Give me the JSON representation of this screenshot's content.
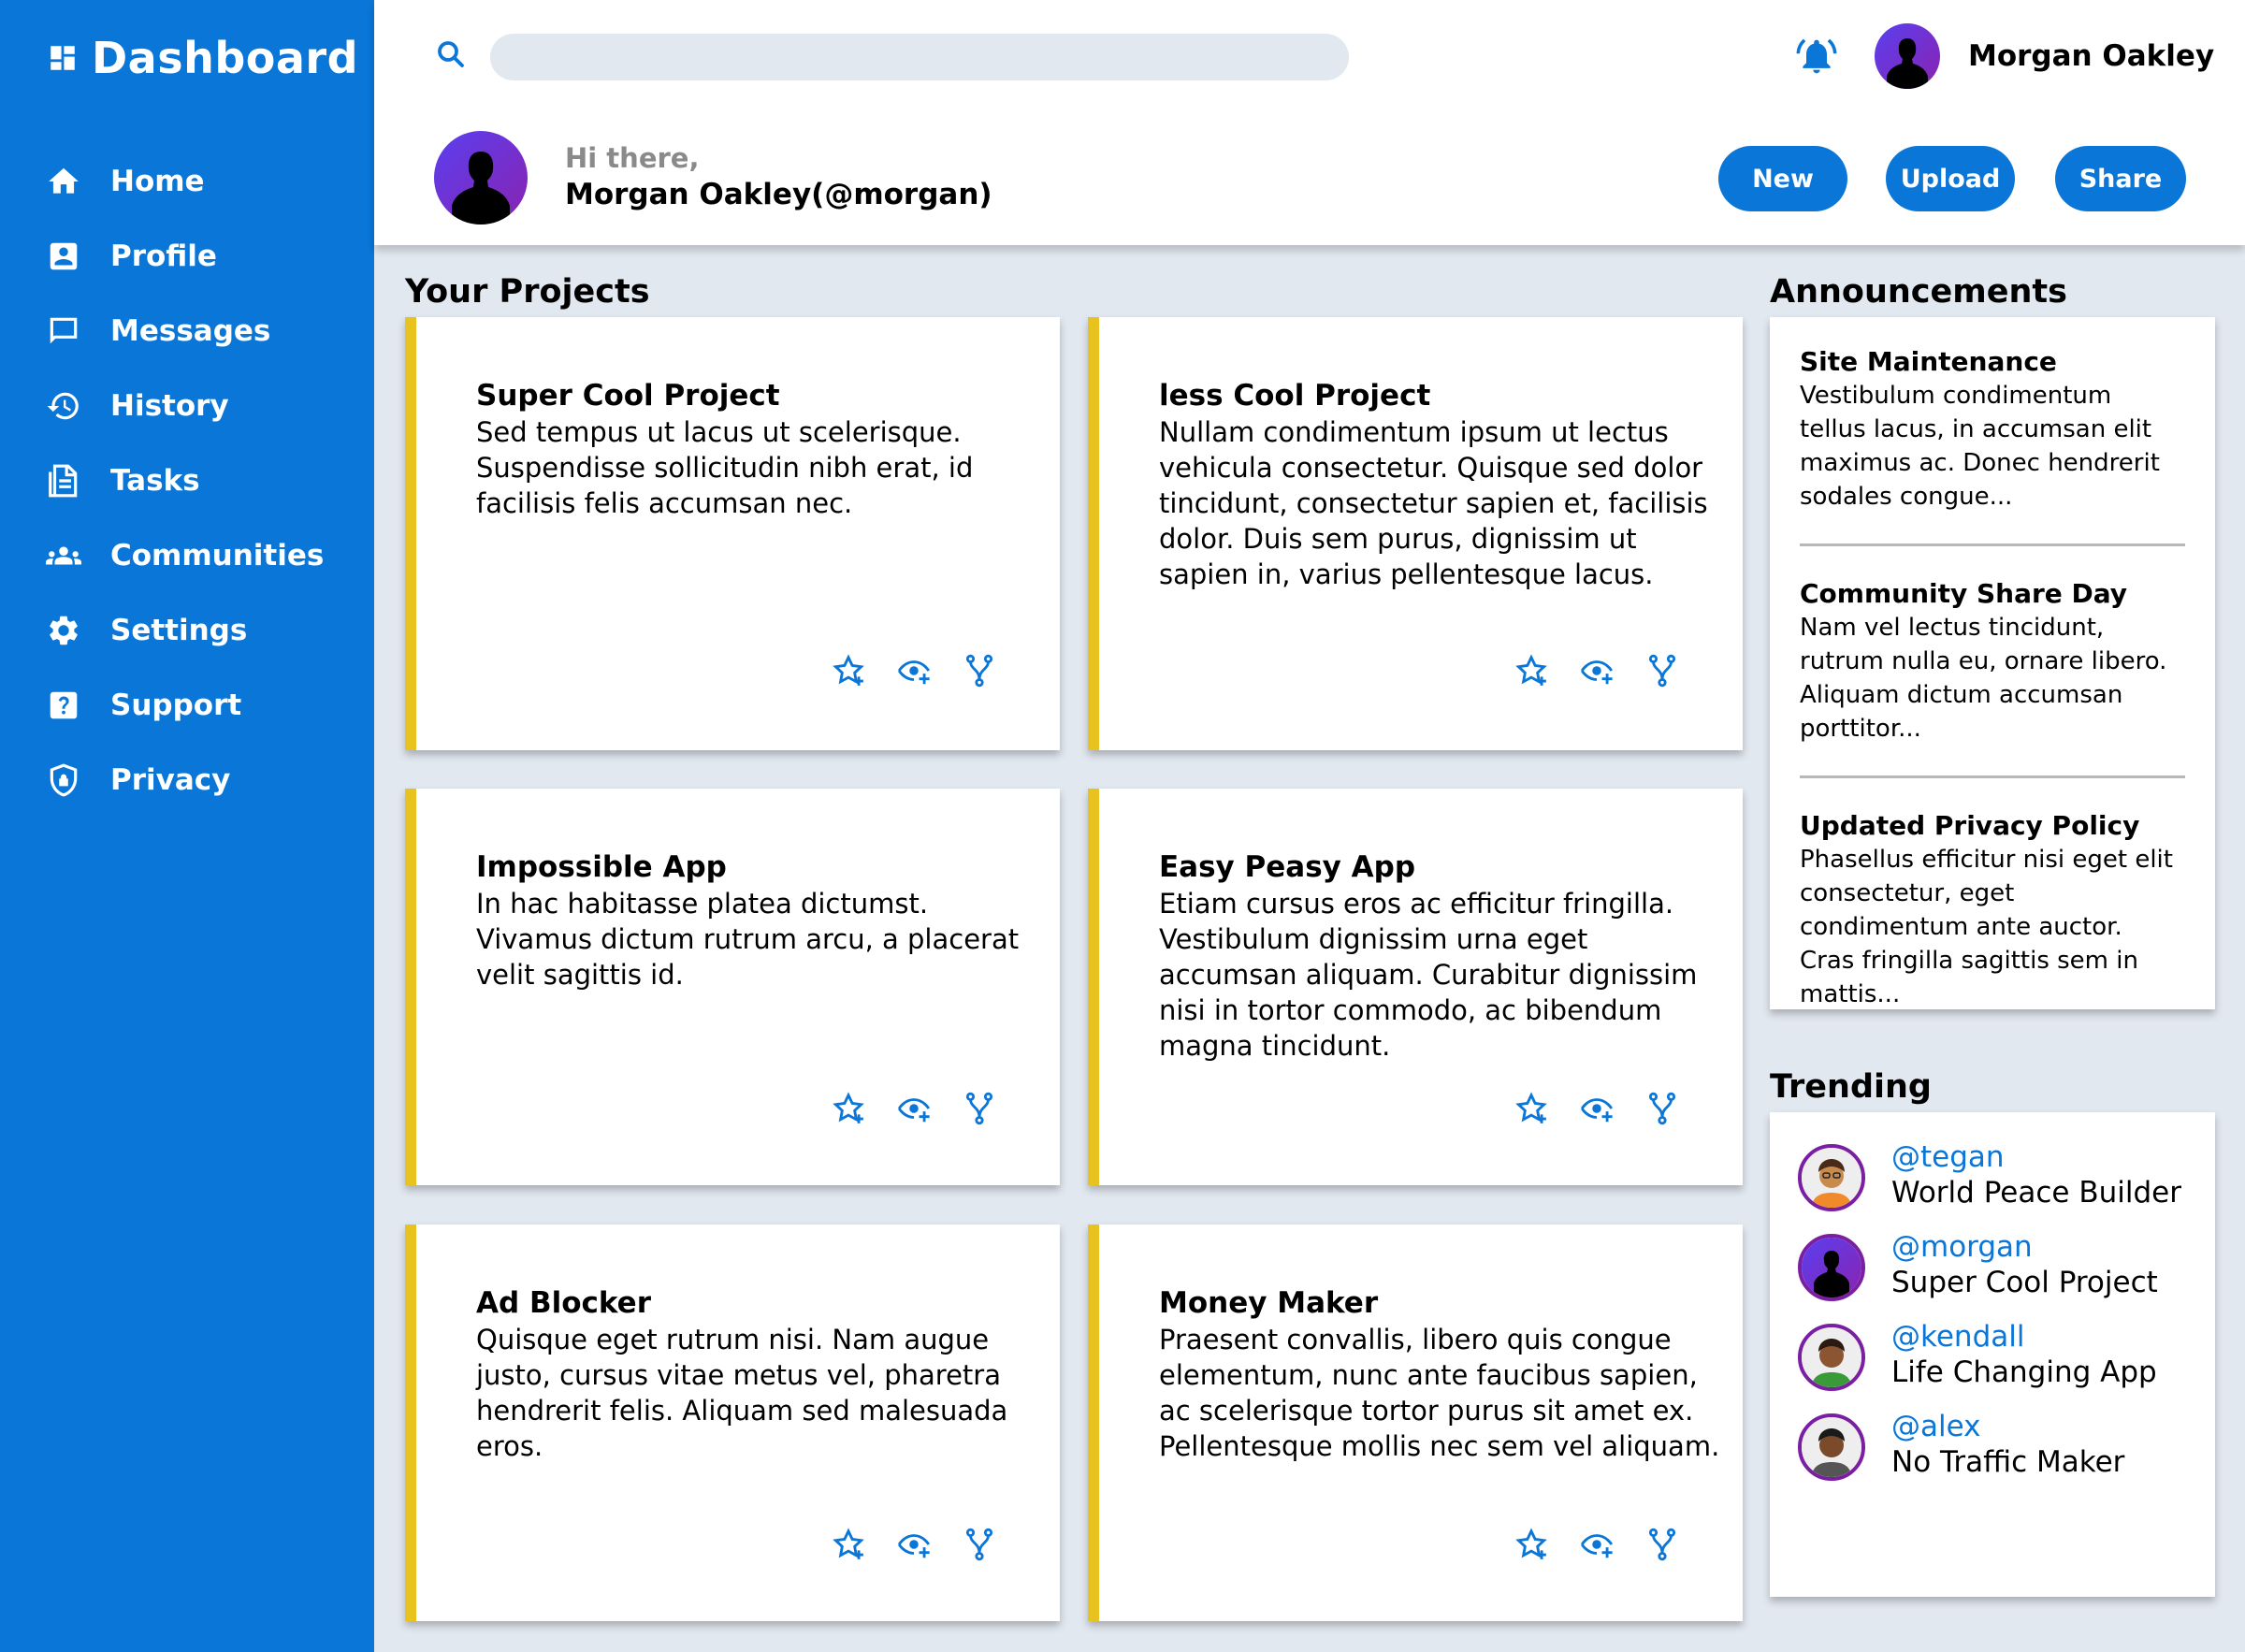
{
  "sidebar": {
    "title": "Dashboard",
    "items": [
      {
        "label": "Home",
        "icon": "home-icon"
      },
      {
        "label": "Profile",
        "icon": "profile-icon"
      },
      {
        "label": "Messages",
        "icon": "message-icon"
      },
      {
        "label": "History",
        "icon": "history-icon"
      },
      {
        "label": "Tasks",
        "icon": "tasks-icon"
      },
      {
        "label": "Communities",
        "icon": "communities-icon"
      },
      {
        "label": "Settings",
        "icon": "gear-icon"
      },
      {
        "label": "Support",
        "icon": "help-icon"
      },
      {
        "label": "Privacy",
        "icon": "shield-icon"
      }
    ]
  },
  "topbar": {
    "search_value": "",
    "user_name": "Morgan Oakley"
  },
  "header": {
    "greeting": "Hi there,",
    "handle": "Morgan Oakley(@morgan)",
    "buttons": {
      "new": "New",
      "upload": "Upload",
      "share": "Share"
    }
  },
  "projects": {
    "title": "Your Projects",
    "cards": [
      {
        "title": "Super Cool Project",
        "text": "Sed tempus ut lacus ut scelerisque. Suspendisse sollicitudin nibh erat, id facilisis felis accumsan nec."
      },
      {
        "title": "less Cool Project",
        "text": "Nullam condimentum ipsum ut lectus vehicula consectetur. Quisque sed dolor tincidunt, consectetur sapien et, facilisis dolor. Duis sem purus, dignissim ut sapien in, varius pellentesque lacus."
      },
      {
        "title": "Impossible App",
        "text": "In hac habitasse platea dictumst. Vivamus dictum rutrum arcu, a placerat velit sagittis id."
      },
      {
        "title": "Easy Peasy App",
        "text": "Etiam cursus eros ac efficitur fringilla. Vestibulum dignissim urna eget accumsan aliquam. Curabitur dignissim nisi in tortor commodo, ac bibendum magna tincidunt."
      },
      {
        "title": "Ad Blocker",
        "text": "Quisque eget rutrum nisi. Nam augue justo, cursus vitae metus vel, pharetra hendrerit felis. Aliquam sed malesuada eros."
      },
      {
        "title": "Money Maker",
        "text": "Praesent convallis, libero quis congue elementum, nunc ante faucibus sapien, ac scelerisque tortor purus sit amet ex. Pellentesque mollis nec sem vel aliquam."
      }
    ]
  },
  "announcements": {
    "title": "Announcements",
    "items": [
      {
        "title": "Site Maintenance",
        "text": "Vestibulum condimentum tellus lacus, in accumsan elit maximus ac. Donec hendrerit sodales congue..."
      },
      {
        "title": "Community Share Day",
        "text": "Nam vel lectus tincidunt, rutrum nulla eu, ornare libero. Aliquam dictum accumsan porttitor..."
      },
      {
        "title": "Updated Privacy Policy",
        "text": "Phasellus efficitur nisi eget elit consectetur, eget condimentum ante auctor. Cras fringilla sagittis sem in mattis..."
      }
    ]
  },
  "trending": {
    "title": "Trending",
    "items": [
      {
        "handle": "@tegan",
        "project": "World Peace Builder"
      },
      {
        "handle": "@morgan",
        "project": "Super Cool Project"
      },
      {
        "handle": "@kendall",
        "project": "Life Changing App"
      },
      {
        "handle": "@alex",
        "project": "No Traffic Maker"
      }
    ]
  },
  "colors": {
    "primary": "#0a76d8",
    "accent": "#e8c21f",
    "background": "#e2e8f0",
    "avatar_ring": "#7a1fa2"
  }
}
